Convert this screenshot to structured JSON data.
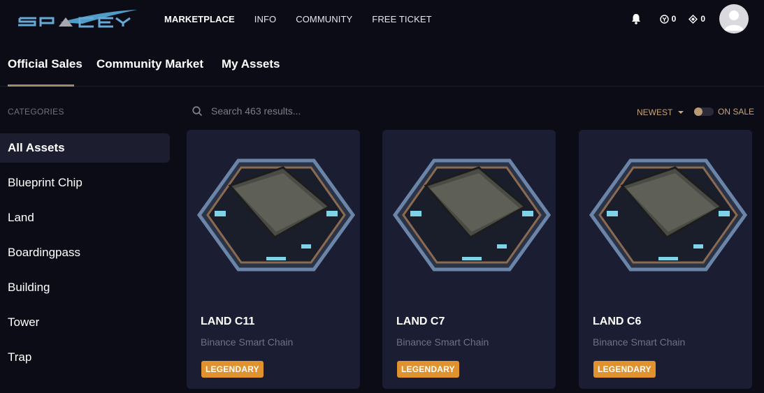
{
  "brand": {
    "logo_text": "SPACEY"
  },
  "nav": [
    {
      "label": "MARKETPLACE",
      "active": true
    },
    {
      "label": "INFO",
      "active": false
    },
    {
      "label": "COMMUNITY",
      "active": false
    },
    {
      "label": "FREE TICKET",
      "active": false
    }
  ],
  "header": {
    "counter_a": "0",
    "counter_b": "0"
  },
  "tabs": [
    {
      "label": "Official Sales",
      "active": true
    },
    {
      "label": "Community Market",
      "active": false
    },
    {
      "label": "My Assets",
      "active": false
    }
  ],
  "sidebar": {
    "title": "CATEGORIES",
    "items": [
      {
        "label": "All Assets",
        "active": true
      },
      {
        "label": "Blueprint Chip",
        "active": false
      },
      {
        "label": "Land",
        "active": false
      },
      {
        "label": "Boardingpass",
        "active": false
      },
      {
        "label": "Building",
        "active": false
      },
      {
        "label": "Tower",
        "active": false
      },
      {
        "label": "Trap",
        "active": false
      }
    ]
  },
  "search": {
    "placeholder": "Search 463 results..."
  },
  "filters": {
    "sort_label": "NEWEST",
    "toggle_label": "ON SALE",
    "on_sale": false
  },
  "cards": [
    {
      "title": "LAND C11",
      "chain": "Binance Smart Chain",
      "rarity": "LEGENDARY"
    },
    {
      "title": "LAND C7",
      "chain": "Binance Smart Chain",
      "rarity": "LEGENDARY"
    },
    {
      "title": "LAND C6",
      "chain": "Binance Smart Chain",
      "rarity": "LEGENDARY"
    }
  ],
  "colors": {
    "background": "#0b0c16",
    "card": "#1b1d33",
    "accent": "#c8a57b",
    "badge": "#e0922e",
    "muted": "#6f7283"
  }
}
